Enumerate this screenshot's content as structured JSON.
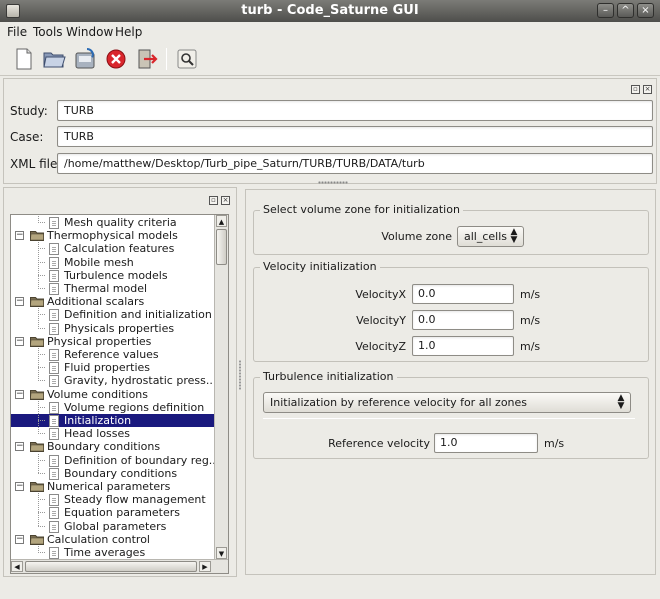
{
  "window": {
    "title": "turb - Code_Saturne GUI"
  },
  "menu": {
    "file": "File",
    "tools": "Tools",
    "window": "Window",
    "help": "Help"
  },
  "toolbar": {
    "new": "new-file-icon",
    "open": "open-folder-icon",
    "save": "save-icon",
    "quit": "stop-icon",
    "exit": "exit-icon",
    "browse": "search-icon"
  },
  "identity": {
    "study_label": "Study:",
    "study_value": "TURB",
    "case_label": "Case:",
    "case_value": "TURB",
    "xml_label": "XML file:",
    "xml_value": "/home/matthew/Desktop/Turb_pipe_Saturn/TURB/TURB/DATA/turb"
  },
  "tree": {
    "items": [
      {
        "label": "Mesh quality criteria",
        "level": 1
      },
      {
        "label": "Thermophysical models",
        "level": 0
      },
      {
        "label": "Calculation features",
        "level": 1
      },
      {
        "label": "Mobile mesh",
        "level": 1
      },
      {
        "label": "Turbulence models",
        "level": 1
      },
      {
        "label": "Thermal model",
        "level": 1
      },
      {
        "label": "Additional scalars",
        "level": 0
      },
      {
        "label": "Definition and initialization",
        "level": 1
      },
      {
        "label": "Physicals properties",
        "level": 1
      },
      {
        "label": "Physical properties",
        "level": 0
      },
      {
        "label": "Reference values",
        "level": 1
      },
      {
        "label": "Fluid properties",
        "level": 1
      },
      {
        "label": "Gravity, hydrostatic press...",
        "level": 1
      },
      {
        "label": "Volume conditions",
        "level": 0
      },
      {
        "label": "Volume regions definition",
        "level": 1
      },
      {
        "label": "Initialization",
        "level": 1
      },
      {
        "label": "Head losses",
        "level": 1
      },
      {
        "label": "Boundary conditions",
        "level": 0
      },
      {
        "label": "Definition of boundary reg...",
        "level": 1
      },
      {
        "label": "Boundary conditions",
        "level": 1
      },
      {
        "label": "Numerical parameters",
        "level": 0
      },
      {
        "label": "Steady flow management",
        "level": 1
      },
      {
        "label": "Equation parameters",
        "level": 1
      },
      {
        "label": "Global parameters",
        "level": 1
      },
      {
        "label": "Calculation control",
        "level": 0
      },
      {
        "label": "Time averages",
        "level": 1
      }
    ]
  },
  "zone": {
    "title": "Select volume zone for initialization",
    "label": "Volume zone",
    "value": "all_cells"
  },
  "velocity": {
    "title": "Velocity initialization",
    "x_label": "VelocityX",
    "x_value": "0.0",
    "x_unit": "m/s",
    "y_label": "VelocityY",
    "y_value": "0.0",
    "y_unit": "m/s",
    "z_label": "VelocityZ",
    "z_value": "1.0",
    "z_unit": "m/s"
  },
  "turbulence": {
    "title": "Turbulence initialization",
    "mode": "Initialization by reference velocity for all zones",
    "ref_label": "Reference velocity",
    "ref_value": "1.0",
    "ref_unit": "m/s"
  },
  "colors": {
    "selection": "#1a197e",
    "folder": "#7a6e52"
  }
}
